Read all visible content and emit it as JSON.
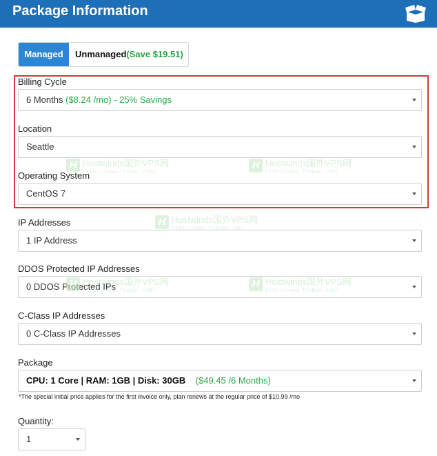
{
  "header": {
    "title": "Package Information",
    "icon": "open-box-icon"
  },
  "tabs": {
    "managed": "Managed",
    "unmanaged_label": "Unmanaged",
    "unmanaged_save": "(Save $19.51)"
  },
  "fields": {
    "billing_cycle": {
      "label": "Billing Cycle",
      "value_main": "6 Months",
      "value_detail": "($8.24 /mo)   -  25% Savings"
    },
    "location": {
      "label": "Location",
      "value": "Seattle"
    },
    "operating_system": {
      "label": "Operating System",
      "value": "CentOS 7"
    },
    "ip_addresses": {
      "label": "IP Addresses",
      "value": "1 IP Address"
    },
    "ddos": {
      "label": "DDOS Protected IP Addresses",
      "value": "0 DDOS Protected IPs"
    },
    "cclass": {
      "label": "C-Class IP Addresses",
      "value": "0 C-Class IP Addresses"
    },
    "package": {
      "label": "Package",
      "value_main": "CPU: 1 Core | RAM: 1GB | Disk: 30GB",
      "value_price": "($49.45 /6 Months)"
    },
    "note": "*The special initial price applies for the first invoice only, plan renews at the regular price of $10.99 /mo",
    "quantity": {
      "label": "Quantity:",
      "value": "1"
    }
  },
  "watermark": {
    "badge": "H",
    "line1": "Hostwinds国外VPS网",
    "line2": "http://www.fixbar.com/"
  },
  "colors": {
    "header_bg": "#1d6fb8",
    "tab_active": "#2c86d6",
    "savings_green": "#28a745",
    "highlight_red": "#d9363e"
  }
}
